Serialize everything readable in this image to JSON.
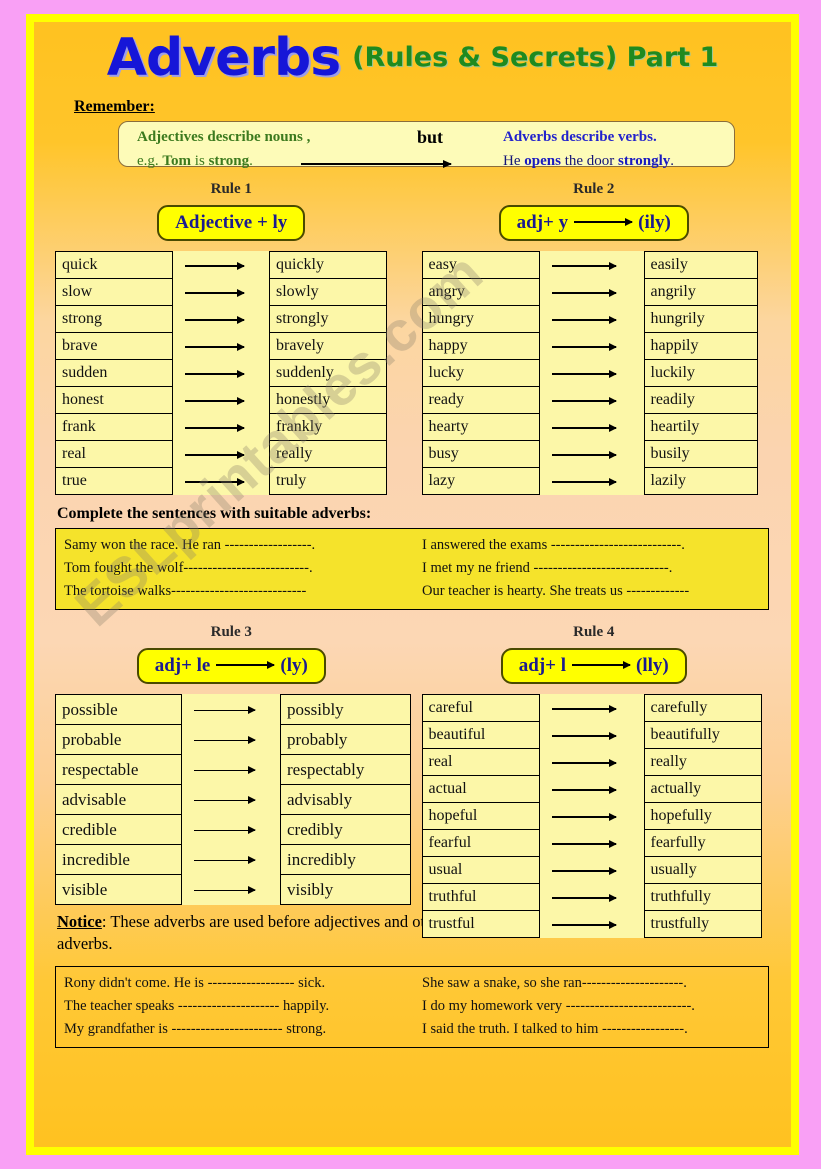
{
  "title": {
    "main": "Adverbs",
    "sub": "(Rules & Secrets) Part 1",
    "main_color": "#1616d8",
    "sub_color": "#1f8a1f"
  },
  "remember": {
    "label": "Remember:",
    "adjectives_text": "Adjectives describe nouns ,",
    "but_text": "but",
    "adverbs_text": "Adverbs describe verbs.",
    "example_left_prefix": "e.g. ",
    "example_left_subject": "Tom",
    "example_left_mid": " is ",
    "example_left_adj": "strong",
    "example_left_end": ".",
    "example_right_prefix": "He ",
    "example_right_verb": "opens",
    "example_right_mid": " the door ",
    "example_right_adv": "strongly",
    "example_right_end": "."
  },
  "rules": [
    {
      "title": "Rule 1",
      "badge_left": "Adjective + ly",
      "badge_has_arrow": false,
      "badge_right": "",
      "pairs": [
        {
          "adj": "quick",
          "adv": "quickly"
        },
        {
          "adj": " slow",
          "adv": "slowly"
        },
        {
          "adj": "strong",
          "adv": "strongly"
        },
        {
          "adj": "brave",
          "adv": "bravely"
        },
        {
          "adj": "sudden",
          "adv": "suddenly"
        },
        {
          "adj": "honest",
          "adv": "honestly"
        },
        {
          "adj": "frank",
          "adv": "frankly"
        },
        {
          "adj": "real",
          "adv": "really"
        },
        {
          "adj": "true",
          "adv": "truly"
        }
      ]
    },
    {
      "title": "Rule 2",
      "badge_left": "adj+ y",
      "badge_has_arrow": true,
      "badge_right": "(ily)",
      "pairs": [
        {
          "adj": "easy",
          "adv": "easily"
        },
        {
          "adj": "angry",
          "adv": "angrily"
        },
        {
          "adj": "hungry",
          "adv": "hungrily"
        },
        {
          "adj": "happy",
          "adv": "happily"
        },
        {
          "adj": "lucky",
          "adv": "luckily"
        },
        {
          "adj": "ready",
          "adv": "readily"
        },
        {
          "adj": "hearty",
          "adv": "heartily"
        },
        {
          "adj": "busy",
          "adv": "busily"
        },
        {
          "adj": "lazy",
          "adv": "lazily"
        }
      ]
    },
    {
      "title": "Rule 3",
      "badge_left": "adj+ le",
      "badge_has_arrow": true,
      "badge_right": "(ly)",
      "pairs": [
        {
          "adj": "possible",
          "adv": "possibly"
        },
        {
          "adj": "probable",
          "adv": "probably"
        },
        {
          "adj": "respectable",
          "adv": "respectably"
        },
        {
          "adj": "advisable",
          "adv": "advisably"
        },
        {
          "adj": "credible",
          "adv": "credibly"
        },
        {
          "adj": "incredible",
          "adv": "incredibly"
        },
        {
          "adj": "visible",
          "adv": "visibly"
        }
      ]
    },
    {
      "title": "Rule 4",
      "badge_left": "adj+ l",
      "badge_has_arrow": true,
      "badge_right": "(lly)",
      "pairs": [
        {
          "adj": "careful",
          "adv": "carefully"
        },
        {
          "adj": "beautiful",
          "adv": "beautifully"
        },
        {
          "adj": "real",
          "adv": "really"
        },
        {
          "adj": "actual",
          "adv": "actually"
        },
        {
          "adj": "hopeful",
          "adv": "hopefully"
        },
        {
          "adj": "fearful",
          "adv": "fearfully"
        },
        {
          "adj": "usual",
          "adv": "usually"
        },
        {
          "adj": "truthful",
          "adv": "truthfully"
        },
        {
          "adj": "trustful",
          "adv": "trustfully"
        }
      ]
    }
  ],
  "exercise1": {
    "heading": "Complete the sentences with suitable adverbs:",
    "left": [
      "Samy won the race. He ran ------------------.",
      "Tom fought the wolf--------------------------.",
      "The tortoise walks----------------------------"
    ],
    "right": [
      "I answered the exams ---------------------------.",
      "I met my ne friend ----------------------------.",
      "Our teacher is hearty. She treats us -------------"
    ]
  },
  "notice": {
    "label": "Notice",
    "text": ": These adverbs are used before adjectives and other adverbs."
  },
  "exercise2": {
    "left": [
      "Rony didn't come. He is ------------------ sick.",
      "The teacher speaks --------------------- happily.",
      "My grandfather is -----------------------  strong."
    ],
    "right": [
      "She saw a snake, so she ran---------------------.",
      "I do my homework very --------------------------.",
      "I said the truth. I talked to him  -----------------."
    ]
  },
  "watermark": {
    "text": "ESLprintables.com"
  },
  "theme": {
    "outer_border": "#f9a0f5",
    "inner_border": "#ffff00",
    "sheet_top": "#ffc220",
    "sheet_mid": "#fbd4b0",
    "badge_bg": "#ffff00",
    "table_bg": "#fcf7a8",
    "exercise_bg": "#f5e32b"
  }
}
